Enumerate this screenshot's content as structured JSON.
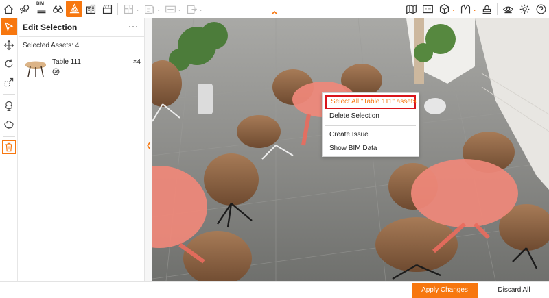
{
  "toolbar": {
    "bim_label": "BIM",
    "left_group": [
      "home-icon",
      "map-pin-icon",
      "bim-icon",
      "binoculars-icon",
      "edit-assets-icon",
      "buildings-icon",
      "clapperboard-icon"
    ],
    "disabled_group": [
      "floor-plan-icon",
      "sheet-icon",
      "360-view-icon",
      "export-icon"
    ],
    "right_group": [
      "map-icon",
      "bim-viewer-icon",
      "cube-icon",
      "measure-icon",
      "stamp-icon",
      "eye-icon",
      "gear-icon",
      "help-icon"
    ],
    "accent_color": "#f7770f"
  },
  "left_tools": [
    "select-icon",
    "move-icon",
    "rotate-icon",
    "scale-icon",
    "tree-icon",
    "bush-icon",
    "trash-icon"
  ],
  "panel": {
    "title": "Edit Selection",
    "menu_label": "···",
    "selected_assets_label": "Selected Assets: 4",
    "asset": {
      "name": "Table 111",
      "quantity": "×4"
    }
  },
  "context_menu": {
    "items": [
      "Select All \"Table 111\" assets",
      "Delete Selection",
      "Create Issue",
      "Show BIM Data"
    ]
  },
  "actions": {
    "apply": "Apply Changes",
    "discard": "Discard All"
  }
}
